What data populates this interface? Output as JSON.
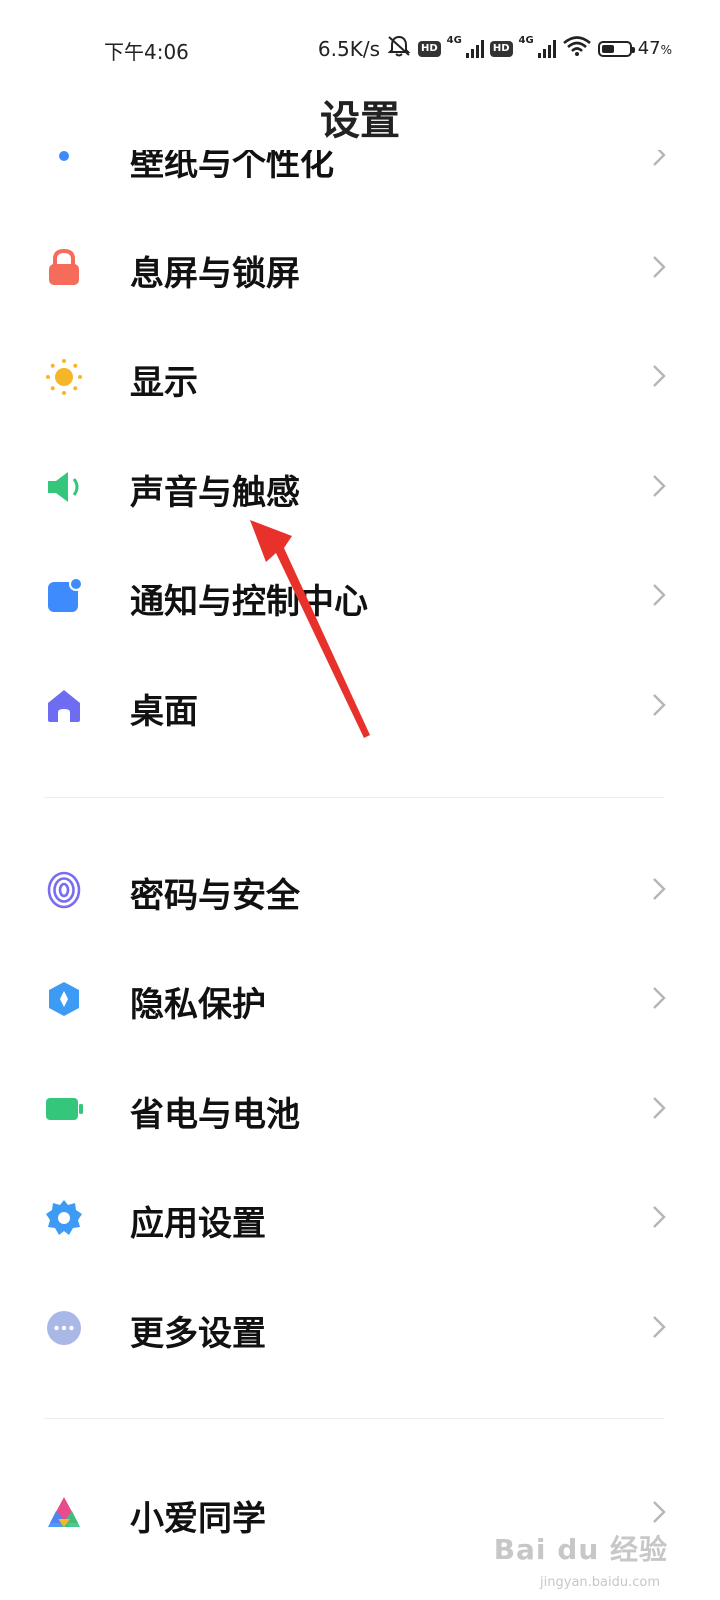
{
  "status_bar": {
    "time": "下午4:06",
    "net_speed": "6.5K/s",
    "sim1_badge": "HD",
    "sim1_net": "4G",
    "sim2_badge": "HD",
    "sim2_net": "4G",
    "battery_level": 0.47,
    "battery_text": "47",
    "battery_unit": "%"
  },
  "page": {
    "title": "设置"
  },
  "groups": [
    {
      "items": [
        {
          "label": "壁纸与个性化",
          "icon": "brush-icon",
          "color": "#3d8bfd"
        },
        {
          "label": "息屏与锁屏",
          "icon": "lock-icon",
          "color": "#f56c5a"
        },
        {
          "label": "显示",
          "icon": "sun-icon",
          "color": "#f5b629"
        },
        {
          "label": "声音与触感",
          "icon": "speaker-icon",
          "color": "#34c77b"
        },
        {
          "label": "通知与控制中心",
          "icon": "notification-icon",
          "color": "#3d8bfd"
        },
        {
          "label": "桌面",
          "icon": "home-icon",
          "color": "#6e6df2"
        }
      ]
    },
    {
      "items": [
        {
          "label": "密码与安全",
          "icon": "fingerprint-icon",
          "color": "#7a6cf0"
        },
        {
          "label": "隐私保护",
          "icon": "privacy-shield-icon",
          "color": "#3d9bf5"
        },
        {
          "label": "省电与电池",
          "icon": "battery-icon",
          "color": "#34c77b"
        },
        {
          "label": "应用设置",
          "icon": "gear-icon",
          "color": "#3d9bf5"
        },
        {
          "label": "更多设置",
          "icon": "more-icon",
          "color": "#a9b8e6"
        }
      ]
    },
    {
      "items": [
        {
          "label": "小爱同学",
          "icon": "xiaoai-icon",
          "color": "#3d8bfd"
        }
      ]
    }
  ],
  "annotation": {
    "arrow_color": "#e8312a"
  },
  "watermark": {
    "brand": "Bai du 经验",
    "url": "jingyan.baidu.com"
  }
}
